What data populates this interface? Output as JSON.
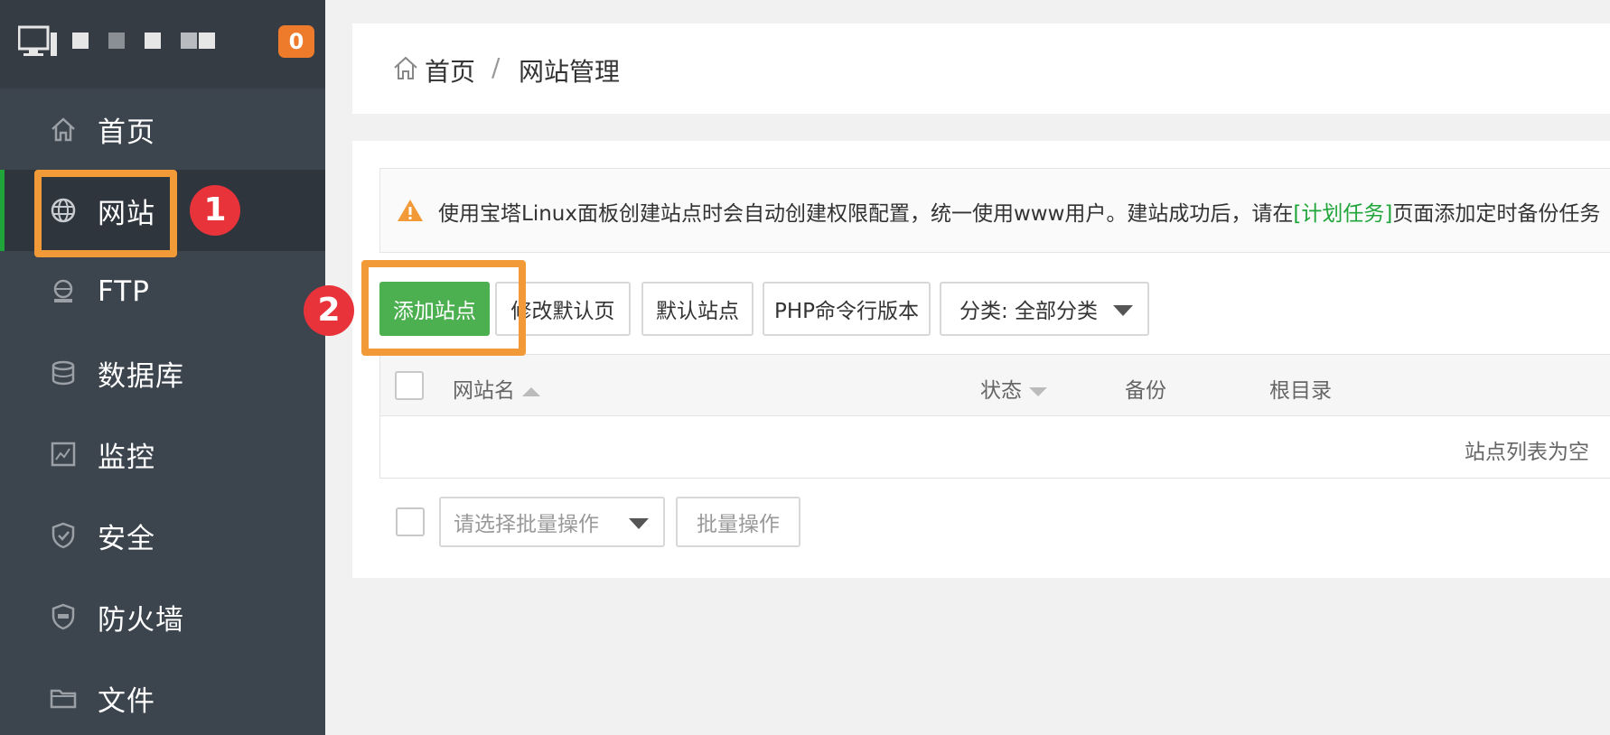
{
  "header": {
    "server_count": "0"
  },
  "sidebar": {
    "items": [
      {
        "label": "首页",
        "icon": "home-icon"
      },
      {
        "label": "网站",
        "icon": "globe-icon",
        "active": true
      },
      {
        "label": "FTP",
        "icon": "ftp-icon"
      },
      {
        "label": "数据库",
        "icon": "database-icon"
      },
      {
        "label": "监控",
        "icon": "monitor-icon"
      },
      {
        "label": "安全",
        "icon": "shield-icon"
      },
      {
        "label": "防火墙",
        "icon": "waf-icon"
      },
      {
        "label": "文件",
        "icon": "folder-icon"
      }
    ]
  },
  "annotations": {
    "step1": "1",
    "step2": "2",
    "callout_color": "#f29a37",
    "badge_color": "#e8333b"
  },
  "breadcrumb": {
    "home": "首页",
    "separator": "/",
    "current": "网站管理"
  },
  "alert": {
    "text_before": "使用宝塔Linux面板创建站点时会自动创建权限配置，统一使用www用户。建站成功后，请在",
    "link": "[计划任务]",
    "text_after": "页面添加定时备份任务"
  },
  "toolbar": {
    "add_site": "添加站点",
    "edit_default_page": "修改默认页",
    "default_site": "默认站点",
    "php_cli_version": "PHP命令行版本",
    "category": "分类: 全部分类"
  },
  "table": {
    "columns": [
      "网站名",
      "状态",
      "备份",
      "根目录"
    ],
    "empty_message": "站点列表为空"
  },
  "batch": {
    "placeholder": "请选择批量操作",
    "button": "批量操作"
  },
  "colors": {
    "sidebar": "#3c444d",
    "accent": "#20a53a",
    "primary_button": "#4caf50",
    "badge": "#ee7b2b"
  }
}
